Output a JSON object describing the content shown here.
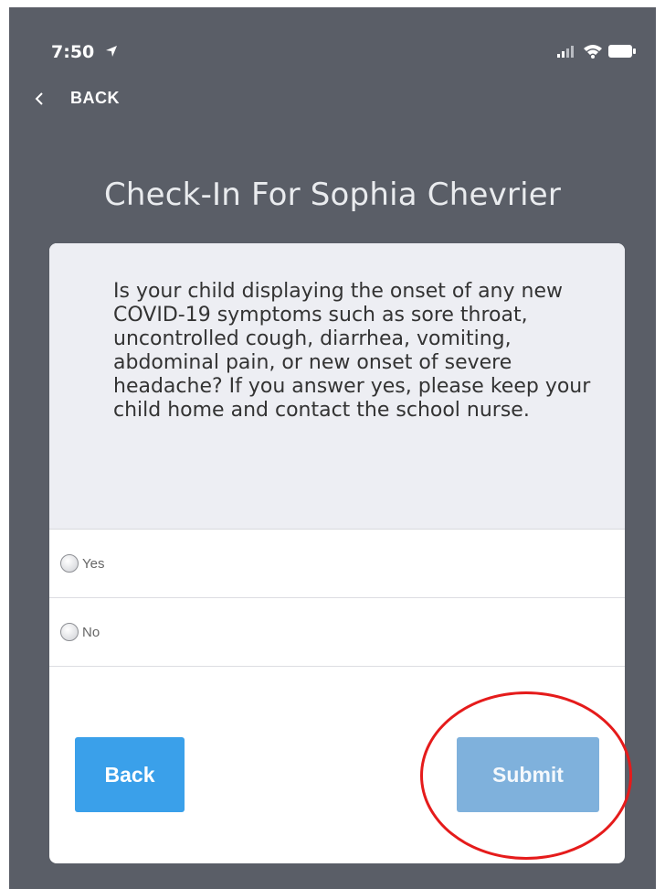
{
  "status_bar": {
    "time": "7:50",
    "icons": [
      "location-arrow-icon",
      "signal-icon",
      "wifi-icon",
      "battery-icon"
    ]
  },
  "nav": {
    "back_label": "BACK",
    "back_icon": "chevron-left-icon"
  },
  "page": {
    "title": "Check-In For Sophia Chevrier"
  },
  "question": {
    "text": "Is your child displaying the onset of any new COVID-19 symptoms such as sore throat, uncontrolled cough, diarrhea, vomiting, abdominal pain, or new onset of severe headache? If you answer yes, please keep your child home and contact the school nurse.",
    "options": [
      {
        "label": "Yes",
        "selected": false
      },
      {
        "label": "No",
        "selected": false
      }
    ]
  },
  "buttons": {
    "back_label": "Back",
    "submit_label": "Submit"
  },
  "colors": {
    "screen_background": "#5a5e67",
    "primary_button": "#3aa0ea",
    "submit_button": "#7fb1dc",
    "annotation": "#e51b1b"
  }
}
